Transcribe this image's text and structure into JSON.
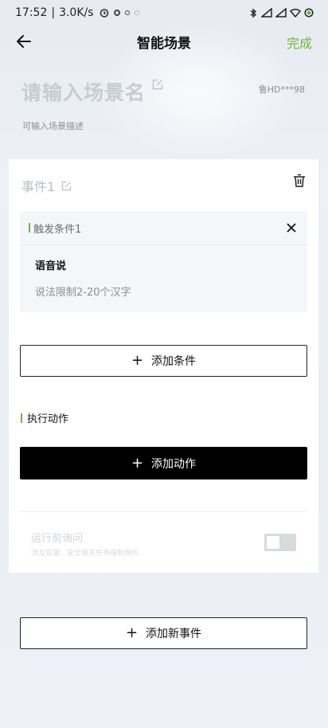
{
  "status_bar": {
    "time": "17:52",
    "separator": "|",
    "net_speed": "3.0K/s"
  },
  "header": {
    "title": "智能场景",
    "done_label": "完成"
  },
  "scene": {
    "name_placeholder": "请输入场景名",
    "plate": "鲁HD***98",
    "desc_placeholder": "可输入场景描述"
  },
  "event": {
    "title": "事件1",
    "trigger": {
      "label": "触发条件1",
      "voice_label": "语音说",
      "voice_hint": "说法限制2-20个汉字"
    },
    "add_condition_label": "添加条件",
    "action_section_label": "执行动作",
    "add_action_label": "添加动作",
    "ask_before_run": {
      "title": "运行前询问",
      "desc": "涉及驾驶、安全相关任务强制询问",
      "enabled": false
    }
  },
  "add_event_label": "添加新事件",
  "plus_symbol": "+",
  "colors": {
    "accent_green": "#6fb33b",
    "black_button": "#000000"
  }
}
